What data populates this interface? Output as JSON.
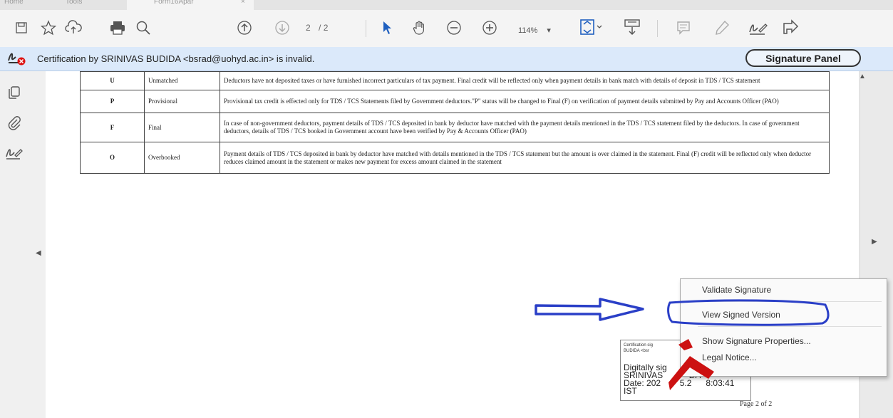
{
  "tabs": {
    "home_label": "Home",
    "tools_label": "Tools",
    "file_label": "Form16Apar",
    "close_label": "×"
  },
  "toolbar": {
    "page_current": "2",
    "page_total": "/ 2",
    "zoom_value": "114%",
    "zoom_dropdown": "▾"
  },
  "signature_bar": {
    "message": "Certification by SRINIVAS BUDIDA <bsrad@uohyd.ac.in> is invalid.",
    "panel_button": "Signature Panel"
  },
  "tax_table": {
    "rows": [
      {
        "code": "U",
        "status": "Unmatched",
        "description": "Deductors have not deposited taxes or have furnished incorrect particulars of tax payment. Final credit will be reflected only when payment details in bank match with details of deposit in TDS / TCS statement"
      },
      {
        "code": "P",
        "status": "Provisional",
        "description": "Provisional tax credit is effected only for TDS / TCS Statements filed by Government deductors.\"P\" status will be changed to Final (F) on verification of payment details submitted by Pay and Accounts Officer (PAO)"
      },
      {
        "code": "F",
        "status": "Final",
        "description": "In case of non-government deductors, payment details of TDS / TCS deposited in bank by deductor have matched with the payment details mentioned in the TDS / TCS statement filed by the deductors. In case of government deductors, details of TDS / TCS booked in Government account have been verified by Pay & Accounts Officer (PAO)"
      },
      {
        "code": "O",
        "status": "Overbooked",
        "description": "Payment details of TDS / TCS deposited in bank by deductor have matched with details mentioned in the TDS / TCS statement but the amount is over claimed in the statement. Final (F) credit will be reflected only when deductor reduces claimed amount in the statement or makes new payment for excess amount claimed in the statement"
      }
    ]
  },
  "signature_box": {
    "header": "Certification sig\nBUDIDA <bsr",
    "body": "Digitally sig\nSRINIVAS           DA\nDate: 202        5.2      8:03:41\nIST"
  },
  "page_footer": "Page 2 of 2",
  "context_menu": {
    "items": [
      {
        "label": "Validate Signature"
      },
      {
        "label": "View Signed Version"
      },
      {
        "label": "Show Signature Properties..."
      },
      {
        "label": "Legal Notice..."
      }
    ]
  },
  "colors": {
    "signature_bar_bg": "#dbe9fa",
    "annotation_blue": "#2a3fc7",
    "annotation_red": "#cc1111"
  }
}
